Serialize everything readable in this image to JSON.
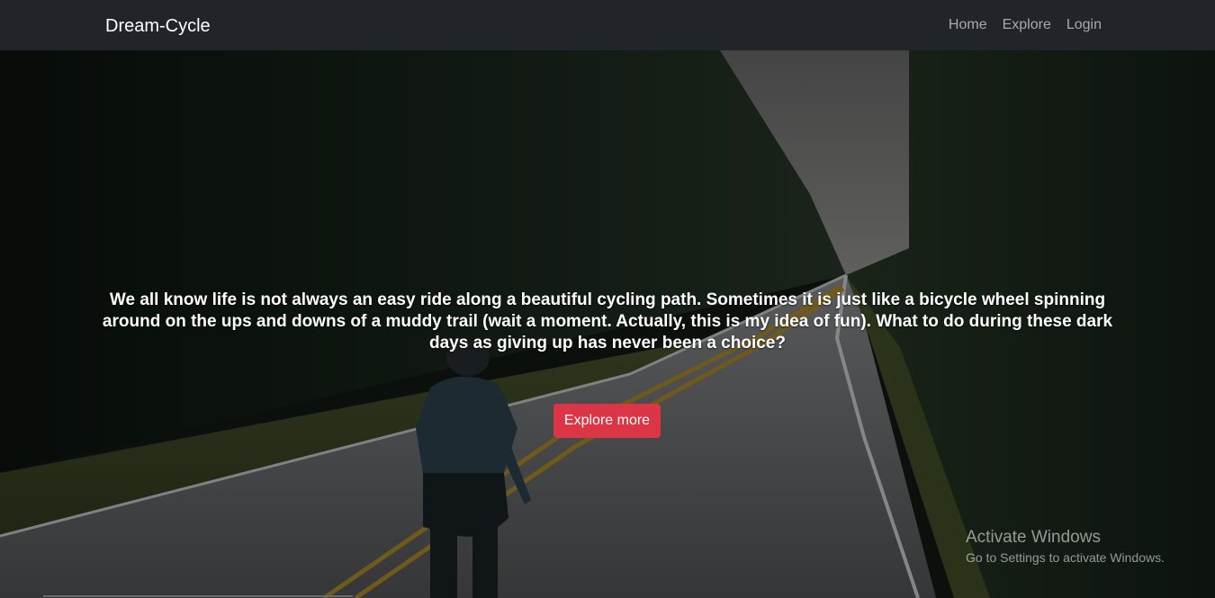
{
  "navbar": {
    "brand": "Dream-Cycle",
    "links": [
      {
        "label": "Home"
      },
      {
        "label": "Explore"
      },
      {
        "label": "Login"
      }
    ]
  },
  "hero": {
    "text": "We all know life is not always an easy ride along a beautiful cycling path. Sometimes it is just like a bicycle wheel spinning around on the ups and downs of a muddy trail (wait a moment. Actually, this is my idea of fun). What to do during these dark days as giving up has never been a choice?",
    "button_label": "Explore more"
  },
  "watermark": {
    "title": "Activate Windows",
    "subtitle": "Go to Settings to activate Windows."
  },
  "colors": {
    "navbar_bg": "#212529",
    "button_bg": "#dc3545",
    "nav_link": "#a7aaad"
  }
}
